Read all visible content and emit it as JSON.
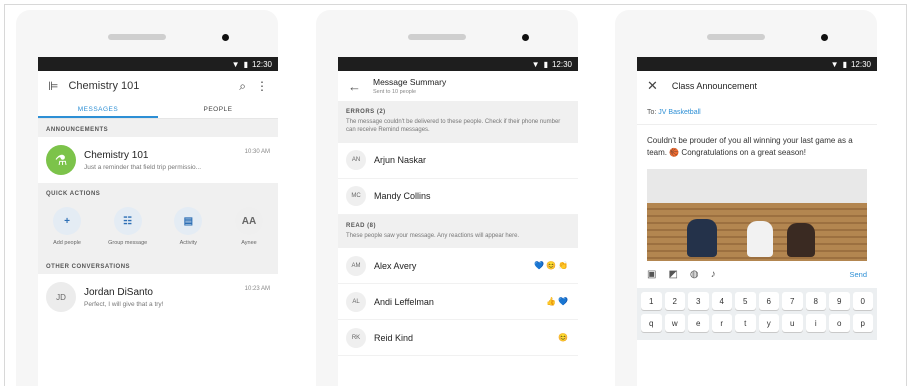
{
  "status": {
    "time": "12:30"
  },
  "screen1": {
    "title": "Chemistry 101",
    "tabs": [
      "MESSAGES",
      "PEOPLE"
    ],
    "announcements_header": "ANNOUNCEMENTS",
    "announcement": {
      "name": "Chemistry 101",
      "preview": "Just a reminder that field trip permissio...",
      "time": "10:30 AM"
    },
    "quick_actions_header": "QUICK ACTIONS",
    "quick_actions": [
      {
        "label": "Add people",
        "glyph": "+"
      },
      {
        "label": "Group message",
        "glyph": "☷"
      },
      {
        "label": "Activity",
        "glyph": "▤"
      },
      {
        "label": "Aynee",
        "glyph": "AA"
      }
    ],
    "other_header": "OTHER CONVERSATIONS",
    "conversation": {
      "initials": "JD",
      "name": "Jordan DiSanto",
      "preview": "Perfect, I will give that a try!",
      "time": "10:23 AM"
    }
  },
  "screen2": {
    "title": "Message Summary",
    "subtitle": "Sent to 10 people",
    "errors_header": "ERRORS (2)",
    "errors_desc": "The message couldn't be delivered to these people. Check if their phone number can receive Remind messages.",
    "error_people": [
      {
        "initials": "AN",
        "name": "Arjun Naskar"
      },
      {
        "initials": "MC",
        "name": "Mandy Collins"
      }
    ],
    "read_header": "READ (8)",
    "read_desc": "These people saw your message. Any reactions will appear here.",
    "read_people": [
      {
        "initials": "AM",
        "name": "Alex Avery",
        "reactions": "💙😊👏"
      },
      {
        "initials": "AL",
        "name": "Andi Leffelman",
        "reactions": "👍💙"
      },
      {
        "initials": "RK",
        "name": "Reid Kind",
        "reactions": "😊"
      }
    ]
  },
  "screen3": {
    "title": "Class Announcement",
    "to_label": "To:",
    "to_value": "JV Basketball",
    "message": "Couldn't be prouder of you all winning your last game as a team. 🏀 Congratulations on a great season!",
    "send_label": "Send",
    "keyboard_row1": [
      "1",
      "2",
      "3",
      "4",
      "5",
      "6",
      "7",
      "8",
      "9",
      "0"
    ],
    "keyboard_row2": [
      "q",
      "w",
      "e",
      "r",
      "t",
      "y",
      "u",
      "i",
      "o",
      "p"
    ]
  },
  "colors": {
    "accent": "#2d8fd5",
    "status_bar": "#1e1e1e",
    "announcement_avatar": "#7cc34a"
  }
}
